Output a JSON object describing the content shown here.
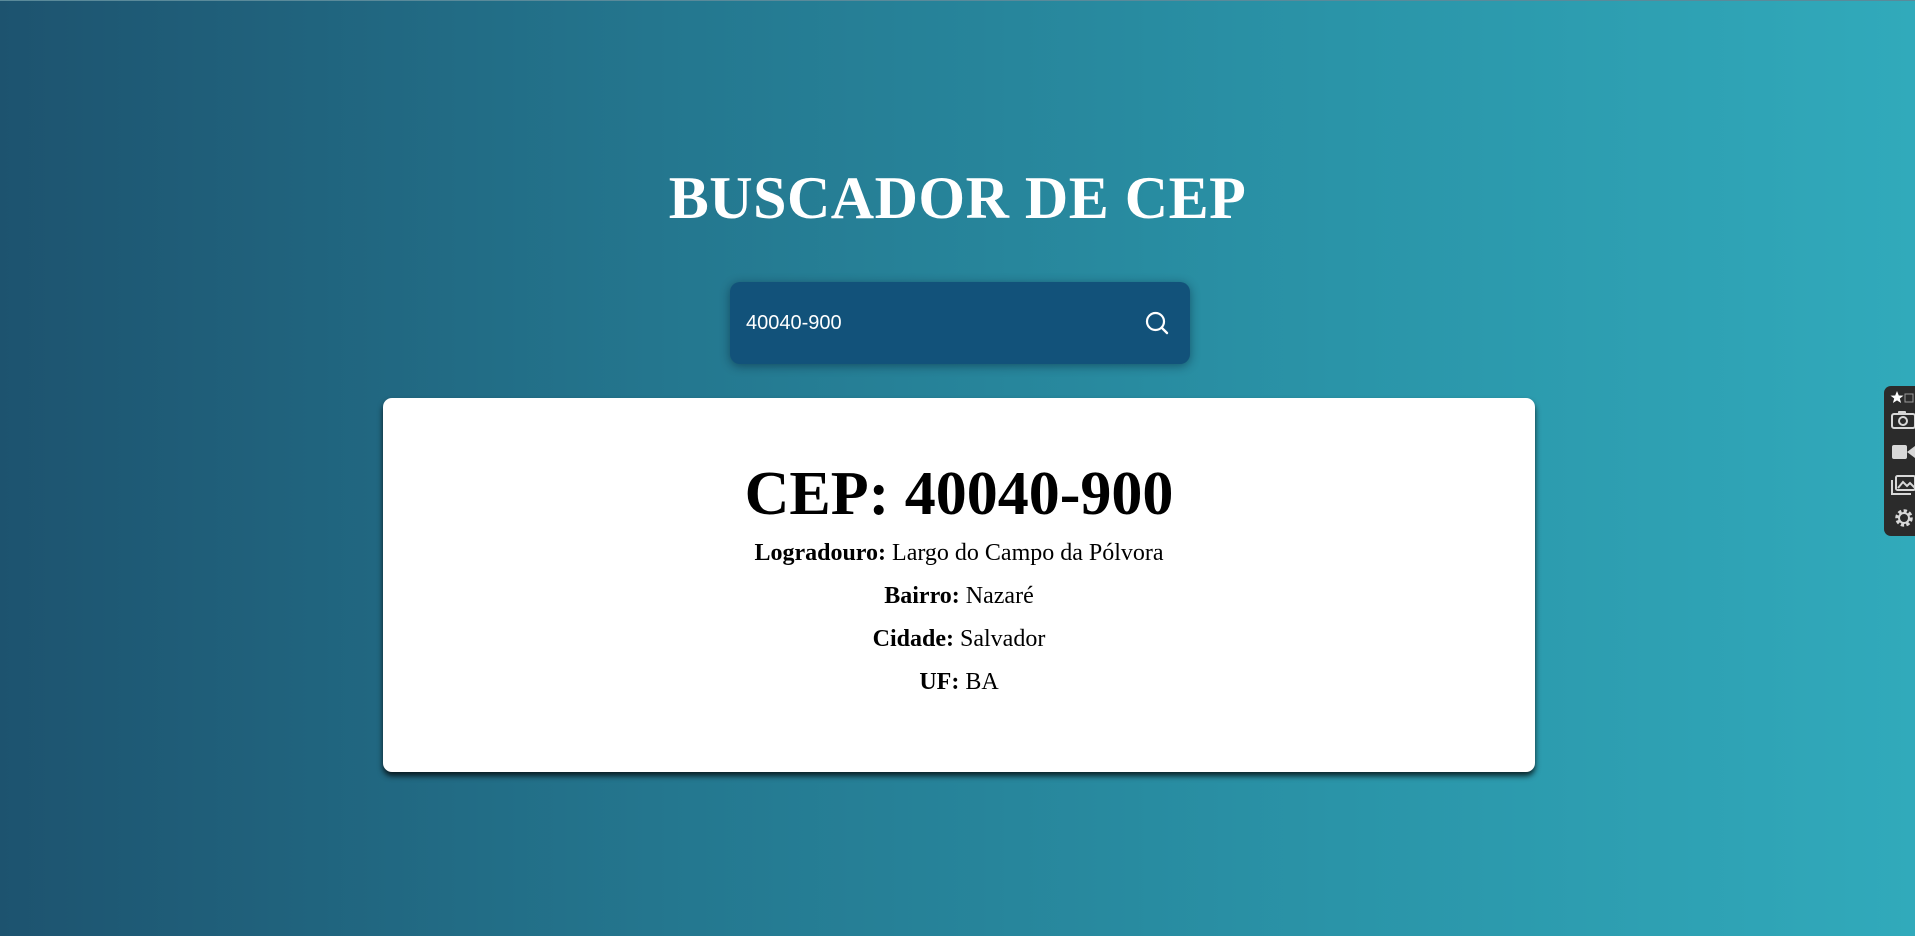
{
  "page": {
    "title": "BUSCADOR DE CEP"
  },
  "search": {
    "value": "40040-900",
    "button_icon": "search-icon"
  },
  "result": {
    "heading": "CEP: 40040-900",
    "fields": [
      {
        "label": "Logradouro:",
        "value": "Largo do Campo da Pólvora"
      },
      {
        "label": "Bairro:",
        "value": "Nazaré"
      },
      {
        "label": "Cidade:",
        "value": "Salvador"
      },
      {
        "label": "UF:",
        "value": "BA"
      }
    ]
  },
  "extension_toolbar": {
    "items": [
      "star-icon",
      "camera-icon",
      "video-icon",
      "gallery-icon",
      "gear-icon"
    ]
  },
  "colors": {
    "gradient_start": "#1d536f",
    "gradient_end": "#31aabb",
    "search_bg": "#12527a",
    "card_bg": "#ffffff",
    "title_text": "#ffffff"
  }
}
